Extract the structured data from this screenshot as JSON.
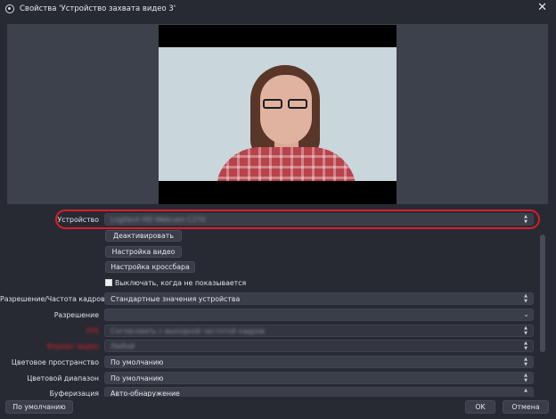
{
  "window": {
    "title": "Свойства 'Устройство захвата видео 3'",
    "close_glyph": "✕"
  },
  "settings": {
    "device": {
      "label": "Устройство",
      "value": "Logitech HD Webcam C270"
    },
    "deactivate_button": "Деактивировать",
    "video_config_button": "Настройка видео",
    "crossbar_config_button": "Настройка кроссбара",
    "deactivate_when_hidden": {
      "label": "Выключать, когда не показывается",
      "checked": false
    },
    "resolution_fps_type": {
      "label": "Разрешение/Частота кадров",
      "value": "Стандартные значения устройства"
    },
    "resolution": {
      "label": "Разрешение",
      "value": ""
    },
    "fps": {
      "label": "FPS",
      "value": "Согласовать с выходной частотой кадров"
    },
    "video_format": {
      "label": "Формат видео",
      "value": "Любой"
    },
    "color_space": {
      "label": "Цветовое пространство",
      "value": "По умолчанию"
    },
    "color_range": {
      "label": "Цветовой диапазон",
      "value": "По умолчанию"
    },
    "buffering": {
      "label": "Буферизация",
      "value": "Авто-обнаружение"
    }
  },
  "footer": {
    "defaults_button": "По умолчанию",
    "ok_button": "OK",
    "cancel_button": "Отмена"
  },
  "colors": {
    "background": "#272a33",
    "highlight": "#d81e2a",
    "warning_label": "#e0202d"
  }
}
